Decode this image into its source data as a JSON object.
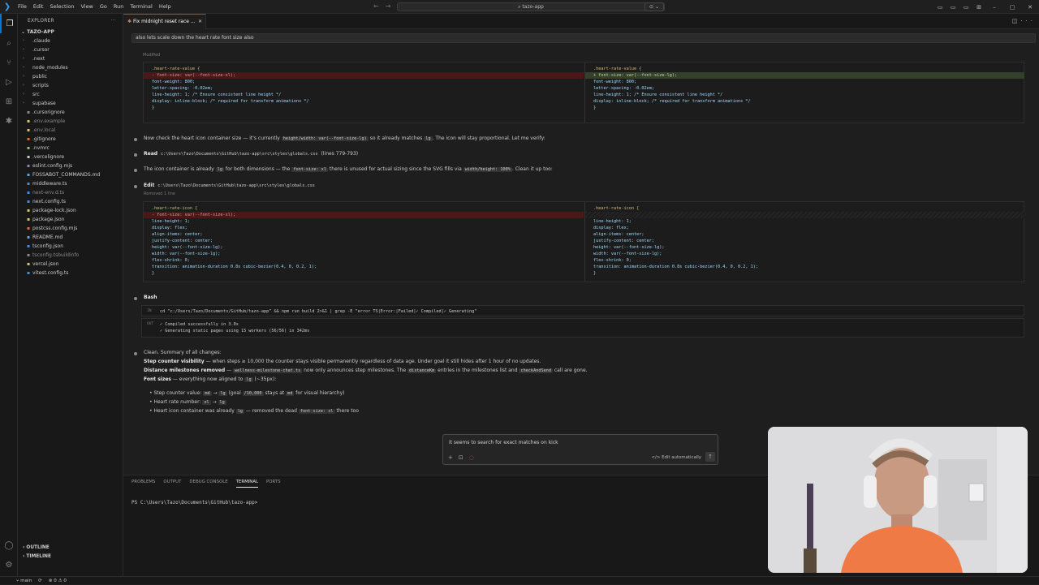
{
  "titlebar": {
    "menu": [
      "File",
      "Edit",
      "Selection",
      "View",
      "Go",
      "Run",
      "Terminal",
      "Help"
    ],
    "search": "tazo-app"
  },
  "explorer": {
    "title": "EXPLORER",
    "project": "TAZO-APP",
    "items": [
      {
        "name": ".claude",
        "type": "folder",
        "icon_color": "#c5c5c5"
      },
      {
        "name": ".cursor",
        "type": "folder",
        "icon_color": "#c5c5c5"
      },
      {
        "name": ".next",
        "type": "folder",
        "icon_color": "#c5c5c5"
      },
      {
        "name": "node_modules",
        "type": "folder",
        "icon_color": "#c5c5c5"
      },
      {
        "name": "public",
        "type": "folder",
        "icon_color": "#c5c5c5"
      },
      {
        "name": "scripts",
        "type": "folder",
        "icon_color": "#c5c5c5"
      },
      {
        "name": "src",
        "type": "folder",
        "icon_color": "#c5c5c5"
      },
      {
        "name": "supabase",
        "type": "folder",
        "icon_color": "#c5c5c5"
      },
      {
        "name": ".cursorignore",
        "type": "file",
        "icon_color": "#8a8a8a"
      },
      {
        "name": ".env.example",
        "type": "file",
        "icon_color": "#d9c26e"
      },
      {
        "name": ".env.local",
        "type": "file",
        "icon_color": "#d9c26e"
      },
      {
        "name": ".gitignore",
        "type": "file",
        "icon_color": "#e06c3c"
      },
      {
        "name": ".nvmrc",
        "type": "file",
        "icon_color": "#8cc265"
      },
      {
        "name": ".vercelignore",
        "type": "file",
        "icon_color": "#cccccc"
      },
      {
        "name": "eslint.config.mjs",
        "type": "file",
        "icon_color": "#8c7de8"
      },
      {
        "name": "FOSSABOT_COMMANDS.md",
        "type": "file",
        "icon_color": "#4fa6ea"
      },
      {
        "name": "middleware.ts",
        "type": "file",
        "icon_color": "#3b8eea"
      },
      {
        "name": "next-env.d.ts",
        "type": "file",
        "icon_color": "#3b8eea"
      },
      {
        "name": "next.config.ts",
        "type": "file",
        "icon_color": "#3b8eea"
      },
      {
        "name": "package-lock.json",
        "type": "file",
        "icon_color": "#d9c26e"
      },
      {
        "name": "package.json",
        "type": "file",
        "icon_color": "#d9c26e"
      },
      {
        "name": "postcss.config.mjs",
        "type": "file",
        "icon_color": "#e06c3c"
      },
      {
        "name": "README.md",
        "type": "file",
        "icon_color": "#4fa6ea"
      },
      {
        "name": "tsconfig.json",
        "type": "file",
        "icon_color": "#3b8eea"
      },
      {
        "name": "tsconfig.tsbuildinfo",
        "type": "file",
        "icon_color": "#8a8a8a"
      },
      {
        "name": "vercel.json",
        "type": "file",
        "icon_color": "#d9c26e"
      },
      {
        "name": "vitest.config.ts",
        "type": "file",
        "icon_color": "#3b8eea"
      }
    ],
    "outline": "OUTLINE",
    "timeline": "TIMELINE"
  },
  "tab": {
    "label": "Fix midnight reset race ..."
  },
  "chat": {
    "user_prompt": "also lets scale down the heart rate font size also",
    "modified_label": "Modified",
    "diff1": {
      "left": [
        {
          "t": ".heart-rate-value {",
          "k": "sel"
        },
        {
          "t": "- font-size: var(--font-size-xl);",
          "k": "del"
        },
        {
          "t": "  font-weight: 800;",
          "k": ""
        },
        {
          "t": "  letter-spacing: -0.02em;",
          "k": ""
        },
        {
          "t": "  line-height: 1; /* Ensure consistent line height */",
          "k": ""
        },
        {
          "t": "  display: inline-block; /* required for transform animations */",
          "k": ""
        },
        {
          "t": "}",
          "k": ""
        }
      ],
      "right": [
        {
          "t": ".heart-rate-value {",
          "k": "sel"
        },
        {
          "t": "+ font-size: var(--font-size-lg);",
          "k": "add"
        },
        {
          "t": "  font-weight: 800;",
          "k": ""
        },
        {
          "t": "  letter-spacing: -0.02em;",
          "k": ""
        },
        {
          "t": "  line-height: 1; /* Ensure consistent line height */",
          "k": ""
        },
        {
          "t": "  display: inline-block; /* required for transform animations */",
          "k": ""
        },
        {
          "t": "}",
          "k": ""
        }
      ]
    },
    "para1": {
      "a": "Now check the heart icon container size — it's currently ",
      "c1": "height/width: var(--font-size-lg)",
      "b": " so it already matches ",
      "c2": "lg",
      "c": ". The icon will stay proportional. Let me verify:"
    },
    "read": {
      "label": "Read",
      "path": "c:\\Users\\Tazo\\Documents\\GitHub\\tazo-app\\src\\styles\\globals.css",
      "lines": "(lines 779-793)"
    },
    "para2": {
      "a": "The icon container is already ",
      "c1": "lg",
      "b": " for both dimensions — the ",
      "c2": "font-size: xl",
      "c": " there is unused for actual sizing since the SVG fills via ",
      "c3": "width/height: 100%",
      "d": ". Clean it up too:"
    },
    "edit": {
      "label": "Edit",
      "path": "c:\\Users\\Tazo\\Documents\\GitHub\\tazo-app\\src\\styles\\globals.css",
      "sub": "Removed 1 line"
    },
    "diff2": {
      "left": [
        {
          "t": ".heart-rate-icon {",
          "k": "sel"
        },
        {
          "t": "- font-size: var(--font-size-xl);",
          "k": "del"
        },
        {
          "t": "  line-height: 1;",
          "k": ""
        },
        {
          "t": "  display: flex;",
          "k": ""
        },
        {
          "t": "  align-items: center;",
          "k": ""
        },
        {
          "t": "  justify-content: center;",
          "k": ""
        },
        {
          "t": "  height: var(--font-size-lg);",
          "k": ""
        },
        {
          "t": "  width: var(--font-size-lg);",
          "k": ""
        },
        {
          "t": "  flex-shrink: 0;",
          "k": ""
        },
        {
          "t": "  transition: animation-duration 0.8s cubic-bezier(0.4, 0, 0.2, 1);",
          "k": ""
        },
        {
          "t": "}",
          "k": ""
        }
      ],
      "right": [
        {
          "t": ".heart-rate-icon {",
          "k": "sel"
        },
        {
          "t": "",
          "k": "blank"
        },
        {
          "t": "  line-height: 1;",
          "k": ""
        },
        {
          "t": "  display: flex;",
          "k": ""
        },
        {
          "t": "  align-items: center;",
          "k": ""
        },
        {
          "t": "  justify-content: center;",
          "k": ""
        },
        {
          "t": "  height: var(--font-size-lg);",
          "k": ""
        },
        {
          "t": "  width: var(--font-size-lg);",
          "k": ""
        },
        {
          "t": "  flex-shrink: 0;",
          "k": ""
        },
        {
          "t": "  transition: animation-duration 0.8s cubic-bezier(0.4, 0, 0.2, 1);",
          "k": ""
        },
        {
          "t": "}",
          "k": ""
        }
      ]
    },
    "bash": {
      "label": "Bash",
      "in_label": "IN",
      "command": "cd \"c:/Users/Tazo/Documents/GitHub/tazo-app\" && npm run build 2>&1 | grep -E \"error TS|Error:|Failed|✓ Compiled|✓ Generating\"",
      "out_label": "OUT",
      "out1": "✓ Compiled successfully in 3.0s",
      "out2": "✓ Generating static pages using 15 workers (56/56) in 342ms"
    },
    "summary": {
      "intro": "Clean. Summary of all changes:",
      "s1_b": "Step counter visibility",
      "s1": " — when steps ≥ 10,000 the counter stays visible permanently regardless of data age. Under goal it still hides after 1 hour of no updates.",
      "s2_b": "Distance milestones removed",
      "s2_a": " — ",
      "s2_c1": "wellness-milestone-chat.ts",
      "s2_b2": " now only announces step milestones. The ",
      "s2_c2": "distanceKm",
      "s2_c": " entries in the milestones list and ",
      "s2_c3": "checkAndSend",
      "s2_d": " call are gone.",
      "s3_b": "Font sizes",
      "s3_a": " — everything now aligned to ",
      "s3_c1": "lg",
      "s3_c": " (~35px):",
      "b1_a": "Step counter value: ",
      "b1_c1": "md",
      "b1_arrow": " → ",
      "b1_c2": "lg",
      "b1_b": " (goal ",
      "b1_c3": "/10,000",
      "b1_c": " stays at ",
      "b1_c4": "md",
      "b1_d": " for visual hierarchy)",
      "b2_a": "Heart rate number: ",
      "b2_c1": "xl",
      "b2_arrow": " → ",
      "b2_c2": "lg",
      "b3_a": "Heart icon container was already ",
      "b3_c1": "lg",
      "b3_b": " — removed the dead ",
      "b3_c2": "font-size: xl",
      "b3_c": " there too"
    },
    "input": {
      "text": "it seems to search for exact matches on kick",
      "mode": "Edit automatically"
    }
  },
  "panel": {
    "tabs": [
      "PROBLEMS",
      "OUTPUT",
      "DEBUG CONSOLE",
      "TERMINAL",
      "PORTS"
    ],
    "active_tab": "TERMINAL",
    "prompt": "PS C:\\Users\\Tazo\\Documents\\GitHub\\tazo-app>"
  },
  "statusbar": {
    "branch": "main",
    "sync": "⟳",
    "problems": "⊗ 0 ⚠ 0"
  }
}
